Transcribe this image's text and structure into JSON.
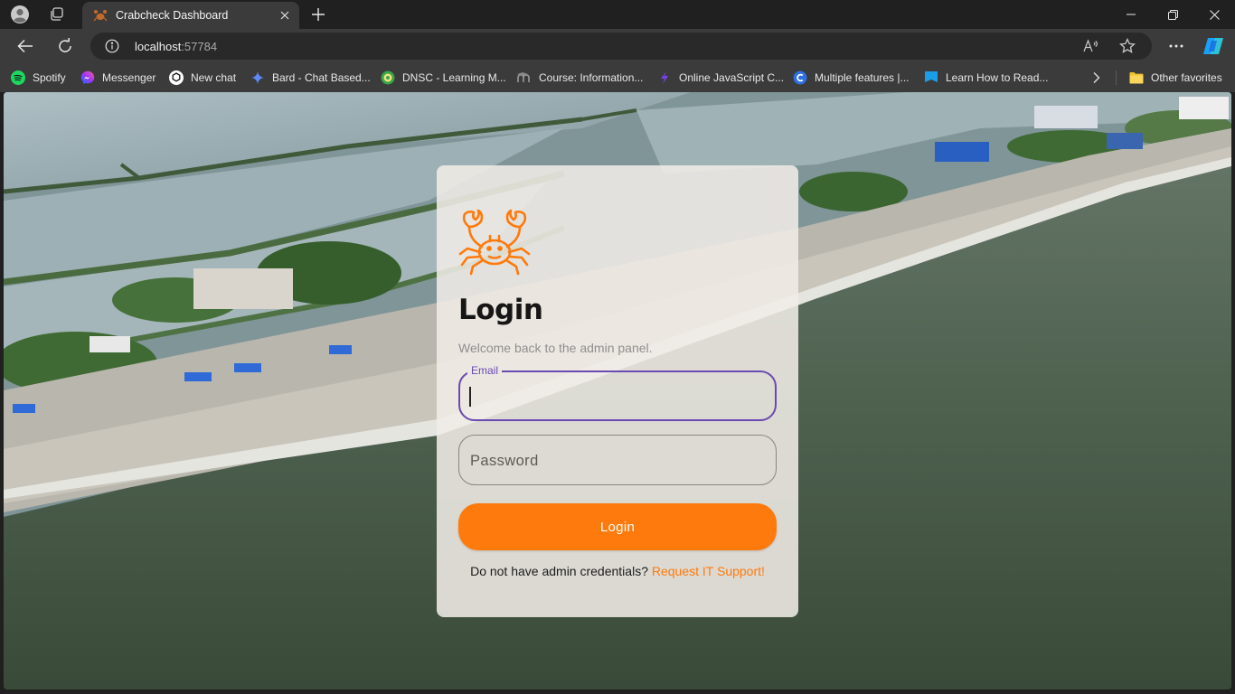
{
  "browser": {
    "tab": {
      "title": "Crabcheck Dashboard"
    },
    "address": {
      "host": "localhost",
      "port": ":57784"
    },
    "bookmarks": [
      {
        "label": "Spotify",
        "icon": "spotify-icon",
        "color": "#1ed760"
      },
      {
        "label": "Messenger",
        "icon": "messenger-icon",
        "color": "#a94cf5"
      },
      {
        "label": "New chat",
        "icon": "chatgpt-icon",
        "color": "#ffffff"
      },
      {
        "label": "Bard - Chat Based...",
        "icon": "bard-icon",
        "color": "#5b8cf7"
      },
      {
        "label": "DNSC - Learning M...",
        "icon": "dnsc-icon",
        "color": "#3aa64a"
      },
      {
        "label": "Course: Information...",
        "icon": "moodle-icon",
        "color": "#9a9a9a"
      },
      {
        "label": "Online JavaScript C...",
        "icon": "js-compiler-icon",
        "color": "#7b3ff2"
      },
      {
        "label": "Multiple features |...",
        "icon": "c-icon",
        "color": "#2f6fe0"
      },
      {
        "label": "Learn How to Read...",
        "icon": "flag-icon",
        "color": "#1b9ee8"
      }
    ],
    "other_favorites": "Other favorites"
  },
  "login": {
    "title": "Login",
    "subtitle": "Welcome back to the admin panel.",
    "email_label": "Email",
    "email_value": "",
    "password_placeholder": "Password",
    "button_label": "Login",
    "footer_text": "Do not have admin credentials? ",
    "support_link": "Request IT Support!"
  },
  "colors": {
    "accent": "#ff7a0d",
    "focus": "#6a4ab0"
  }
}
